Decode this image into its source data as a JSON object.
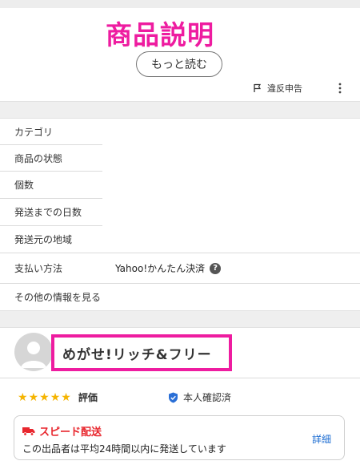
{
  "headline": "商品説明",
  "more_button": "もっと読む",
  "report_label": "違反申告",
  "details": [
    {
      "label": "カテゴリ",
      "value": ""
    },
    {
      "label": "商品の状態",
      "value": ""
    },
    {
      "label": "個数",
      "value": ""
    },
    {
      "label": "発送までの日数",
      "value": ""
    },
    {
      "label": "発送元の地域",
      "value": ""
    },
    {
      "label": "支払い方法",
      "value": "Yahoo!かんたん決済"
    },
    {
      "label": "その他の情報を見る",
      "value": ""
    }
  ],
  "seller": {
    "name": "めがせ!リッチ&フリー",
    "rating_label": "評価",
    "stars": 5,
    "verified_label": "本人確認済"
  },
  "speed": {
    "title": "スピード配送",
    "desc": "この出品者は平均24時間以内に発送しています",
    "link": "詳細"
  },
  "colors": {
    "accent_pink": "#ee1ca0",
    "star": "#f5b400",
    "speed_red": "#e8262d",
    "link_blue": "#1a6bd1"
  }
}
